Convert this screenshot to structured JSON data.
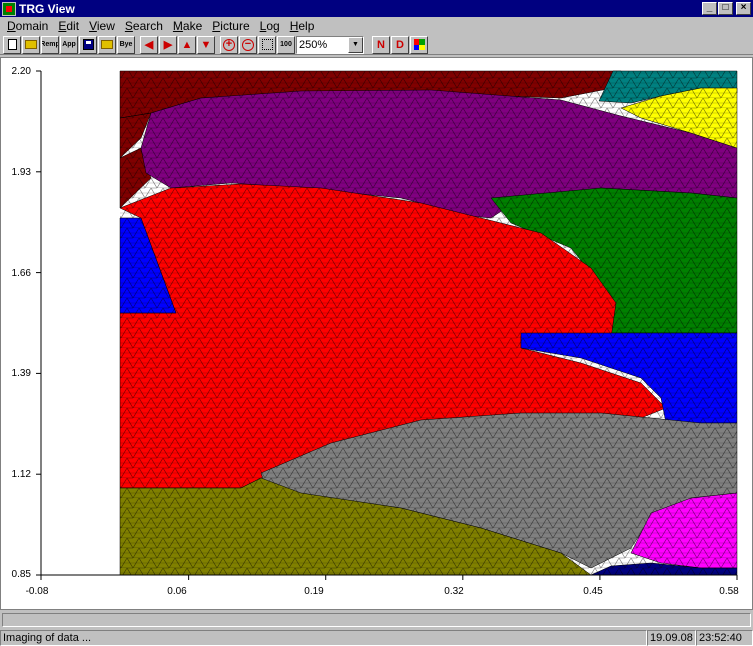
{
  "window": {
    "title": "TRG View",
    "btn_min": "_",
    "btn_max": "□",
    "btn_close": "×"
  },
  "menu": [
    "Domain",
    "Edit",
    "View",
    "Search",
    "Make",
    "Picture",
    "Log",
    "Help"
  ],
  "toolbar": {
    "remap_label": "Remp",
    "app_label": "App",
    "bye_label": "Bye",
    "hundred_label": "100",
    "zoom_value": "250%",
    "n_label": "N",
    "d_label": "D"
  },
  "plot": {
    "y_ticks": [
      "2.20",
      "1.93",
      "1.66",
      "1.39",
      "1.12",
      "0.85"
    ],
    "x_ticks": [
      "-0.08",
      "0.06",
      "0.19",
      "0.32",
      "0.45",
      "0.58"
    ],
    "y_range": [
      0.85,
      2.2
    ],
    "x_range": [
      -0.08,
      0.58
    ],
    "region_colors": {
      "darkred": "#800000",
      "purple": "#800080",
      "teal": "#008080",
      "yellow": "#ffff00",
      "green": "#008000",
      "red": "#ff0000",
      "blue": "#0000ff",
      "gray": "#808080",
      "olive": "#808000",
      "magenta": "#ff00ff"
    }
  },
  "status": {
    "message": "Imaging of data ...",
    "date": "19.09.08",
    "time": "23:52:40"
  }
}
